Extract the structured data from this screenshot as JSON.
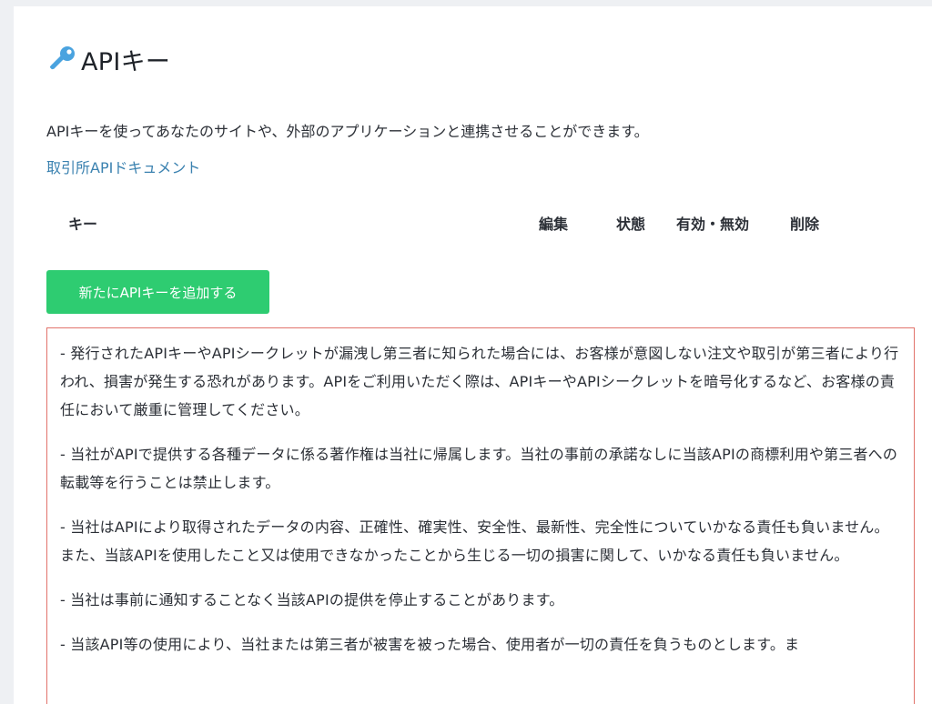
{
  "header": {
    "icon": "key-icon",
    "title": "APIキー"
  },
  "intro": {
    "text": "APIキーを使ってあなたのサイトや、外部のアプリケーションと連携させることができます。",
    "doc_link": "取引所APIドキュメント"
  },
  "table": {
    "columns": [
      "キー",
      "編集",
      "状態",
      "有効・無効",
      "削除"
    ]
  },
  "add_button": {
    "label": "新たにAPIキーを追加する"
  },
  "notice": {
    "paragraphs": [
      "- 発行されたAPIキーやAPIシークレットが漏洩し第三者に知られた場合には、お客様が意図しない注文や取引が第三者により行われ、損害が発生する恐れがあります。APIをご利用いただく際は、APIキーやAPIシークレットを暗号化するなど、お客様の責任において厳重に管理してください。",
      "- 当社がAPIで提供する各種データに係る著作権は当社に帰属します。当社の事前の承諾なしに当該APIの商標利用や第三者への転載等を行うことは禁止します。",
      "- 当社はAPIにより取得されたデータの内容、正確性、確実性、安全性、最新性、完全性についていかなる責任も負いません。また、当該APIを使用したこと又は使用できなかったことから生じる一切の損害に関して、いかなる責任も負いません。",
      "- 当社は事前に通知することなく当該APIの提供を停止することがあります。",
      "- 当該API等の使用により、当社または第三者が被害を被った場合、使用者が一切の責任を負うものとします。ま"
    ]
  },
  "colors": {
    "accent_green": "#2ecc71",
    "link_blue": "#3b82b0",
    "notice_border": "#e2736b",
    "icon_blue": "#4aa3df"
  }
}
